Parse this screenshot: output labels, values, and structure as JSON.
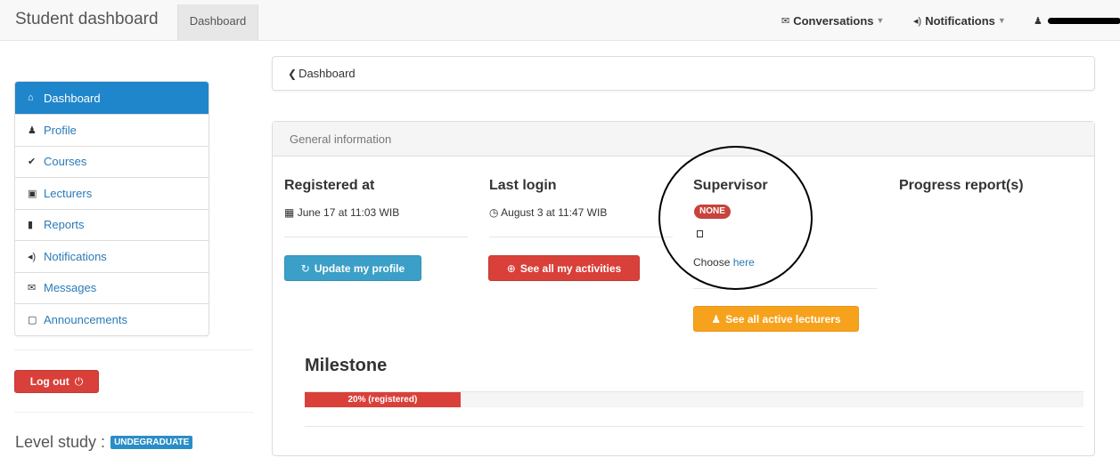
{
  "navbar": {
    "brand": "Student dashboard",
    "tab": "Dashboard",
    "conversations": {
      "icon": "envelope-icon",
      "label": "Conversations"
    },
    "notifications": {
      "icon": "volume-icon",
      "label": "Notifications"
    },
    "user": {
      "icon": "user-icon"
    }
  },
  "sidebar": {
    "items": [
      {
        "label": "Dashboard",
        "icon": "home-icon",
        "glyph": "⌂",
        "active": true
      },
      {
        "label": "Profile",
        "icon": "user-icon",
        "glyph": "♟"
      },
      {
        "label": "Courses",
        "icon": "check-circle-icon",
        "glyph": "✔"
      },
      {
        "label": "Lecturers",
        "icon": "briefcase-icon",
        "glyph": "▣"
      },
      {
        "label": "Reports",
        "icon": "book-icon",
        "glyph": "▮"
      },
      {
        "label": "Notifications",
        "icon": "volume-icon",
        "glyph": "◂)"
      },
      {
        "label": "Messages",
        "icon": "envelope-icon",
        "glyph": "✉"
      },
      {
        "label": "Announcements",
        "icon": "inbox-icon",
        "glyph": "▢"
      }
    ],
    "logout": "Log out",
    "level_label": "Level study :",
    "level_value": "UNDEGRADUATE"
  },
  "breadcrumb": {
    "label": "Dashboard"
  },
  "panel": {
    "heading": "General information",
    "registered": {
      "title": "Registered at",
      "value": "June 17 at 11:03 WIB",
      "button": "Update my profile"
    },
    "last_login": {
      "title": "Last login",
      "value": "August 3 at 11:47 WIB",
      "button": "See all my activities"
    },
    "supervisor": {
      "title": "Supervisor",
      "badge": "NONE",
      "choose_text": "Choose",
      "choose_link": "here",
      "button": "See all active lecturers"
    },
    "progress_reports": {
      "title": "Progress report(s)"
    },
    "milestone": {
      "title": "Milestone",
      "progress_label": "20% (registered)",
      "progress_percent": 20
    }
  },
  "colors": {
    "primary": "#1f86cc",
    "danger": "#d9403a",
    "info": "#3c9fc8",
    "warning": "#f7a21c"
  }
}
